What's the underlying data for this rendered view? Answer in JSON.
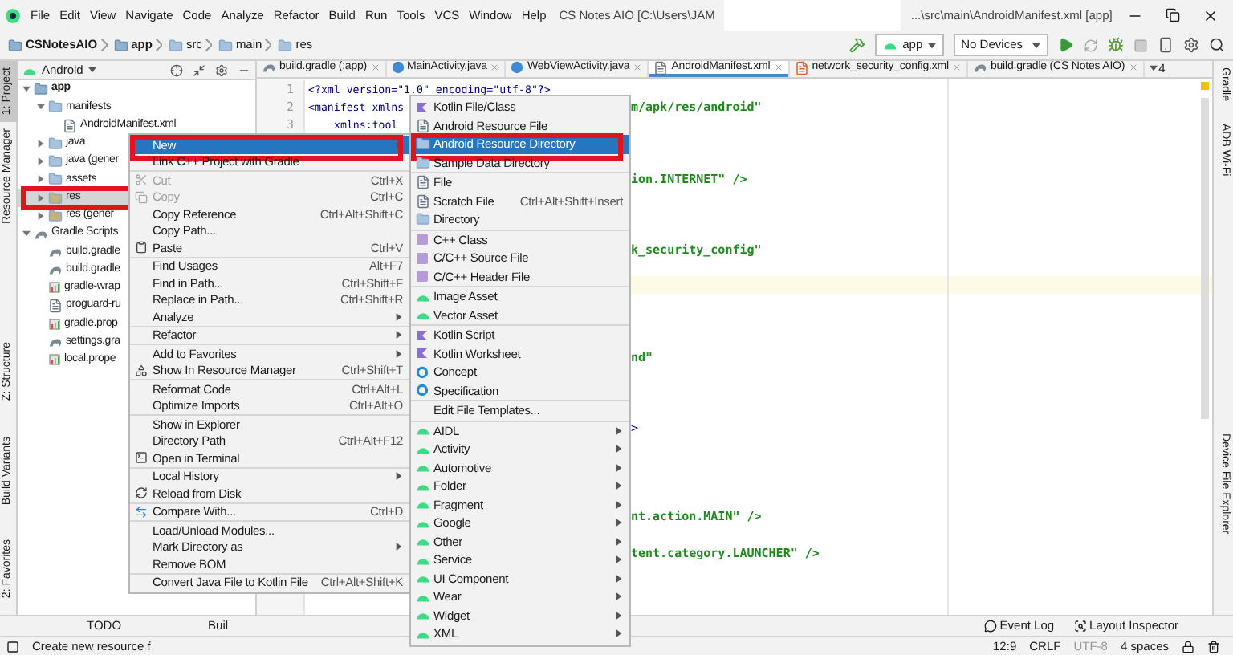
{
  "menu_bar": {
    "items": [
      "File",
      "Edit",
      "View",
      "Navigate",
      "Code",
      "Analyze",
      "Refactor",
      "Build",
      "Run",
      "Tools",
      "VCS",
      "Window",
      "Help"
    ],
    "title_left": "CS Notes AIO [C:\\Users\\JAM",
    "title_right": "...\\src\\main\\AndroidManifest.xml [app]"
  },
  "breadcrumb": [
    {
      "label": "CSNotesAIO",
      "kind": "module"
    },
    {
      "label": "app",
      "kind": "module"
    },
    {
      "label": "src",
      "kind": "folder"
    },
    {
      "label": "main",
      "kind": "folder"
    },
    {
      "label": "res",
      "kind": "folder"
    }
  ],
  "run_config": "app",
  "device": "No Devices",
  "project_view": {
    "title": "Android"
  },
  "tabs": [
    {
      "label": "build.gradle (:app)",
      "kind": "gradle",
      "selected": false
    },
    {
      "label": "MainActivity.java",
      "kind": "class",
      "selected": false
    },
    {
      "label": "WebViewActivity.java",
      "kind": "class",
      "selected": false
    },
    {
      "label": "AndroidManifest.xml",
      "kind": "xml",
      "selected": true
    },
    {
      "label": "network_security_config.xml",
      "kind": "xmlres",
      "selected": false
    },
    {
      "label": "build.gradle (CS Notes AIO)",
      "kind": "gradle",
      "selected": false
    }
  ],
  "tab_overflow": "4",
  "tree": [
    {
      "label": "app",
      "kind": "module",
      "expanded": true,
      "selected": false,
      "children": [
        {
          "label": "manifests",
          "kind": "folder",
          "expanded": true,
          "selected": false,
          "children": [
            {
              "label": "AndroidManifest.xml",
              "kind": "xml",
              "selected": false
            }
          ]
        },
        {
          "label": "java",
          "kind": "folder",
          "expanded": false,
          "selected": false
        },
        {
          "label": "java (gener",
          "kind": "folder",
          "expanded": false,
          "selected": false
        },
        {
          "label": "assets",
          "kind": "folder",
          "expanded": false,
          "selected": false
        },
        {
          "label": "res",
          "kind": "resfolder",
          "expanded": false,
          "selected": true,
          "annotated": true
        },
        {
          "label": "res (gener",
          "kind": "resfolder",
          "expanded": false,
          "selected": false
        }
      ]
    },
    {
      "label": "Gradle Scripts",
      "kind": "gradle",
      "expanded": true,
      "selected": false,
      "children": [
        {
          "label": "build.gradle",
          "kind": "gradle",
          "selected": false
        },
        {
          "label": "build.gradle",
          "kind": "gradle",
          "selected": false
        },
        {
          "label": "gradle-wrap",
          "kind": "properties",
          "selected": false
        },
        {
          "label": "proguard-ru",
          "kind": "file",
          "selected": false
        },
        {
          "label": "gradle.prop",
          "kind": "properties",
          "selected": false
        },
        {
          "label": "settings.gra",
          "kind": "gradle",
          "selected": false
        },
        {
          "label": "local.prope",
          "kind": "properties",
          "selected": false
        }
      ]
    }
  ],
  "editor": {
    "lines": [
      {
        "number": "1",
        "text": "<?xml version=\"1.0\" encoding=\"utf-8\"?>"
      },
      {
        "number": "2",
        "text": "<manifest xmlns"
      },
      {
        "number": "3",
        "text": "xmlns:tool"
      }
    ],
    "fragments": [
      {
        "text": "m/apk/res/android\"",
        "kind": "string"
      },
      {
        "text": "ion.INTERNET\" />",
        "kind": "string"
      },
      {
        "text": "k_security_config\"",
        "kind": "string"
      },
      {
        "text": "nd\"",
        "kind": "string"
      },
      {
        "text": ">",
        "kind": "tag"
      },
      {
        "text": "nt.action.MAIN\" />",
        "kind": "string"
      },
      {
        "text": "tent.category.LAUNCHER\" />",
        "kind": "string"
      }
    ],
    "current_line": true
  },
  "context_menu": {
    "groups": [
      [
        {
          "label": "New",
          "submenu": true,
          "selected": true,
          "annotated": true
        },
        {
          "label": "Link C++ Project with Gradle",
          "selected": false
        }
      ],
      [
        {
          "label": "Cut",
          "shortcut": "Ctrl+X",
          "kind": "scissors",
          "disabled": true,
          "selected": false
        },
        {
          "label": "Copy",
          "shortcut": "Ctrl+C",
          "kind": "copy",
          "disabled": true,
          "selected": false
        },
        {
          "label": "Copy Reference",
          "shortcut": "Ctrl+Alt+Shift+C",
          "selected": false
        },
        {
          "label": "Copy Path...",
          "selected": false
        },
        {
          "label": "Paste",
          "shortcut": "Ctrl+V",
          "kind": "paste",
          "selected": false
        }
      ],
      [
        {
          "label": "Find Usages",
          "shortcut": "Alt+F7",
          "selected": false
        },
        {
          "label": "Find in Path...",
          "shortcut": "Ctrl+Shift+F",
          "selected": false
        },
        {
          "label": "Replace in Path...",
          "shortcut": "Ctrl+Shift+R",
          "selected": false
        },
        {
          "label": "Analyze",
          "submenu": true,
          "selected": false
        }
      ],
      [
        {
          "label": "Refactor",
          "submenu": true,
          "selected": false
        }
      ],
      [
        {
          "label": "Add to Favorites",
          "submenu": true,
          "selected": false
        },
        {
          "label": "Show In Resource Manager",
          "shortcut": "Ctrl+Shift+T",
          "kind": "resource",
          "selected": false
        }
      ],
      [
        {
          "label": "Reformat Code",
          "shortcut": "Ctrl+Alt+L",
          "selected": false
        },
        {
          "label": "Optimize Imports",
          "shortcut": "Ctrl+Alt+O",
          "selected": false
        }
      ],
      [
        {
          "label": "Show in Explorer",
          "selected": false
        },
        {
          "label": "Directory Path",
          "shortcut": "Ctrl+Alt+F12",
          "selected": false
        },
        {
          "label": "Open in Terminal",
          "kind": "terminal",
          "selected": false
        }
      ],
      [
        {
          "label": "Local History",
          "submenu": true,
          "selected": false
        },
        {
          "label": "Reload from Disk",
          "kind": "reload",
          "selected": false
        }
      ],
      [
        {
          "label": "Compare With...",
          "shortcut": "Ctrl+D",
          "kind": "compare",
          "selected": false
        }
      ],
      [
        {
          "label": "Load/Unload Modules...",
          "selected": false
        },
        {
          "label": "Mark Directory as",
          "submenu": true,
          "selected": false
        },
        {
          "label": "Remove BOM",
          "selected": false
        }
      ],
      [
        {
          "label": "Convert Java File to Kotlin File",
          "shortcut": "Ctrl+Alt+Shift+K",
          "selected": false
        }
      ]
    ]
  },
  "submenu": {
    "groups": [
      [
        {
          "label": "Kotlin File/Class",
          "kind": "kotlin",
          "selected": false
        },
        {
          "label": "Android Resource File",
          "kind": "file",
          "selected": false
        },
        {
          "label": "Android Resource Directory",
          "kind": "folder",
          "selected": true,
          "annotated": true
        },
        {
          "label": "Sample Data Directory",
          "kind": "folder",
          "selected": false
        }
      ],
      [
        {
          "label": "File",
          "kind": "file",
          "selected": false
        },
        {
          "label": "Scratch File",
          "shortcut": "Ctrl+Alt+Shift+Insert",
          "kind": "file",
          "selected": false
        },
        {
          "label": "Directory",
          "kind": "folder",
          "selected": false
        }
      ],
      [
        {
          "label": "C++ Class",
          "kind": "cpp",
          "selected": false
        },
        {
          "label": "C/C++ Source File",
          "kind": "cpp",
          "selected": false
        },
        {
          "label": "C/C++ Header File",
          "kind": "cpp",
          "selected": false
        }
      ],
      [
        {
          "label": "Image Asset",
          "kind": "android",
          "selected": false
        },
        {
          "label": "Vector Asset",
          "kind": "android",
          "selected": false
        }
      ],
      [
        {
          "label": "Kotlin Script",
          "kind": "kotlin",
          "selected": false
        },
        {
          "label": "Kotlin Worksheet",
          "kind": "kotlin",
          "selected": false
        },
        {
          "label": "Concept",
          "kind": "ring",
          "selected": false
        },
        {
          "label": "Specification",
          "kind": "ring",
          "selected": false
        }
      ],
      [
        {
          "label": "Edit File Templates...",
          "selected": false
        }
      ],
      [
        {
          "label": "AIDL",
          "kind": "android",
          "submenu": true,
          "selected": false
        },
        {
          "label": "Activity",
          "kind": "android",
          "submenu": true,
          "selected": false
        },
        {
          "label": "Automotive",
          "kind": "android",
          "submenu": true,
          "selected": false
        },
        {
          "label": "Folder",
          "kind": "android",
          "submenu": true,
          "selected": false
        },
        {
          "label": "Fragment",
          "kind": "android",
          "submenu": true,
          "selected": false
        },
        {
          "label": "Google",
          "kind": "android",
          "submenu": true,
          "selected": false
        },
        {
          "label": "Other",
          "kind": "android",
          "submenu": true,
          "selected": false
        },
        {
          "label": "Service",
          "kind": "android",
          "submenu": true,
          "selected": false
        },
        {
          "label": "UI Component",
          "kind": "android",
          "submenu": true,
          "selected": false
        },
        {
          "label": "Wear",
          "kind": "android",
          "submenu": true,
          "selected": false
        },
        {
          "label": "Widget",
          "kind": "android",
          "submenu": true,
          "selected": false
        },
        {
          "label": "XML",
          "kind": "android",
          "submenu": true,
          "selected": false
        }
      ]
    ]
  },
  "left_tool_windows": [
    {
      "label": "1: Project",
      "selected": true
    },
    {
      "label": "Resource Manager",
      "selected": false
    },
    {
      "label": "Z: Structure",
      "selected": false
    },
    {
      "label": "Build Variants",
      "selected": false
    },
    {
      "label": "2: Favorites",
      "selected": false
    }
  ],
  "right_tool_windows": [
    "Gradle",
    "ADB Wi-Fi",
    "Device File Explorer"
  ],
  "bottom_tools": [
    "TODO",
    "Buil"
  ],
  "bottom_right": [
    "Event Log",
    "Layout Inspector"
  ],
  "status": {
    "message": "Create new resource f",
    "position": "12:9",
    "line_separator": "CRLF",
    "encoding": "UTF-8",
    "indent": "4 spaces"
  }
}
